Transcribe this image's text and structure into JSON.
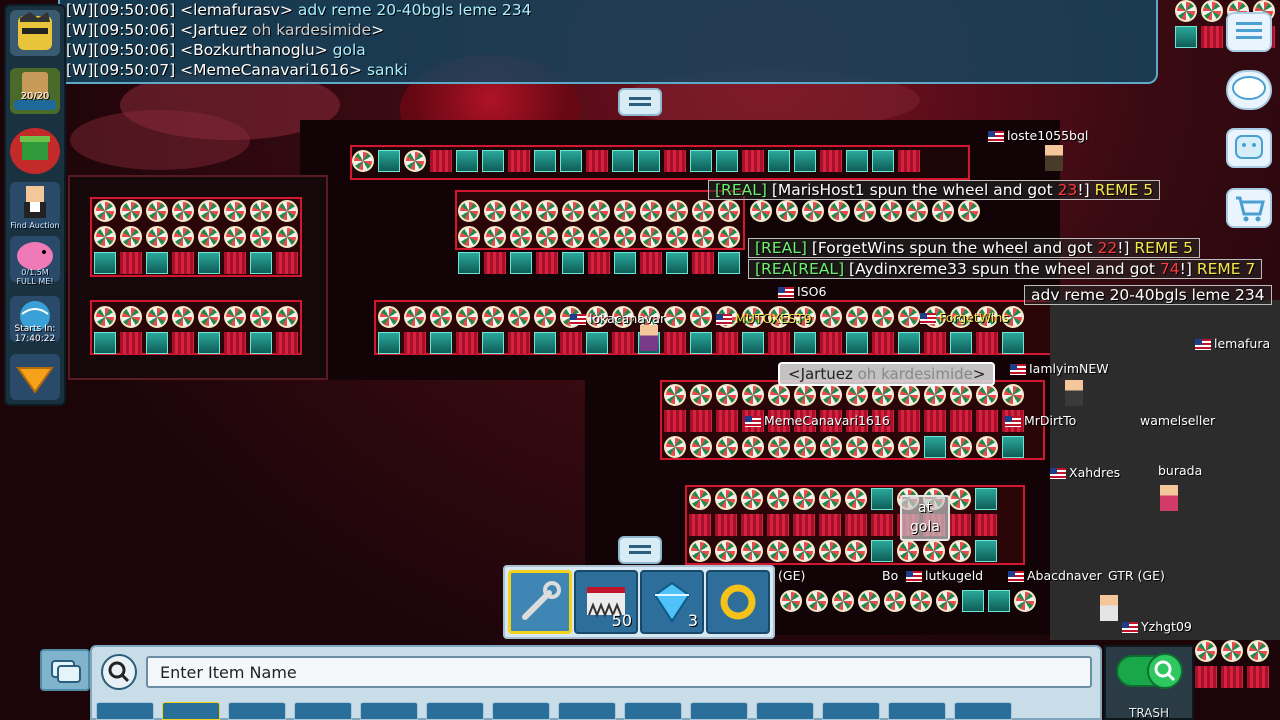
{
  "chat": {
    "lines": [
      {
        "prefix": "[W][09:50:06]",
        "name": "<lemafurasv>",
        "msg": "adv reme 20-40bgls leme 234"
      },
      {
        "prefix": "[W][09:50:06]",
        "name": "<Jartuez",
        "msg": "oh kardesimide",
        "close": ">"
      },
      {
        "prefix": "[W][09:50:06]",
        "name": "<Bozkurthanoglu>",
        "msg": "gola"
      },
      {
        "prefix": "[W][09:50:07]",
        "name": "<MemeCanavari1616>",
        "msg": "sanki"
      }
    ]
  },
  "sidebar": {
    "level_badge": "20/20",
    "find_auction_label": "Find Auction",
    "piggy_label": "0/1.5M\nFULL ME!",
    "starts_label": "Starts In:\n17:40:22"
  },
  "wheel_messages": [
    {
      "real": "[REAL]",
      "text": " [MarisHost1 spun the wheel and got ",
      "num": "23",
      "end": "!]",
      "reme": " REME 5"
    },
    {
      "real": "[REAL]",
      "text": " [ForgetWins spun the wheel and got ",
      "num": "22",
      "end": "!]",
      "reme": " REME 5"
    },
    {
      "real": "[REA",
      "real2": "[REAL]",
      "text": " [Aydinxreme33 spun the wheel and got ",
      "num": "74",
      "end": "!]",
      "reme": " REME 7"
    }
  ],
  "adv_bubble": "adv reme 20-40bgls leme 234",
  "jartuez_bubble": {
    "name": "<Jartuez",
    "msg": "oh kardesimide",
    "close": ">"
  },
  "say_bubble": {
    "line1": "at",
    "line2": "gola"
  },
  "players": {
    "p1": "loste1055bgl",
    "p2": "ISO6",
    "p3": "ForgetWins",
    "p4": "IamlyimNEW",
    "p5": "lemafura",
    "p6": "MrDirtTo",
    "p7": "MemeCanavari1616",
    "p8": "Xahdres",
    "p9": "wamelseller",
    "p10": "burada",
    "p11": "Yzhgt09",
    "p12": "lokacanavar",
    "p13": "MUTOXEST9",
    "p14": "(GE)",
    "p15": "Bo",
    "p16": "lutkugeld",
    "p17": "Abacdnaver",
    "p18": "GTR (GE)"
  },
  "hotbar": {
    "slots": [
      {
        "icon": "wrench-icon",
        "count": ""
      },
      {
        "icon": "spike-block-icon",
        "count": "50"
      },
      {
        "icon": "blue-gem-lock-icon",
        "count": "3"
      },
      {
        "icon": "gold-ring-icon",
        "count": ""
      }
    ]
  },
  "search": {
    "placeholder": "Enter Item Name"
  },
  "trash": {
    "label": "TRASH"
  },
  "colors": {
    "accent_red": "#d2172e",
    "chat_bg": "#14465f",
    "real_green": "#6ef06e",
    "reme_yellow": "#f5e84a"
  }
}
